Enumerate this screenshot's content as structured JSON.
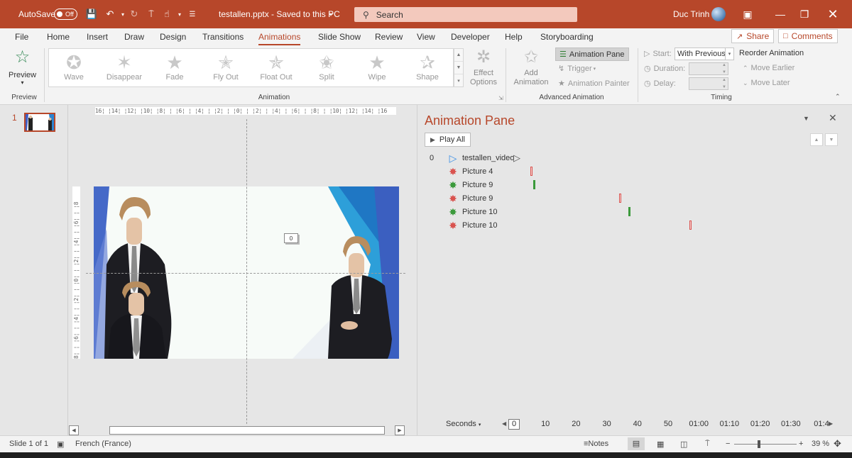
{
  "titlebar": {
    "autosave_label": "AutoSave",
    "autosave_state": "Off",
    "document": "testallen.pptx  -  Saved to this PC",
    "search_placeholder": "Search",
    "user": "Duc Trinh",
    "accent": "#b7472a"
  },
  "menu": {
    "tabs": [
      "File",
      "Home",
      "Insert",
      "Draw",
      "Design",
      "Transitions",
      "Animations",
      "Slide Show",
      "Review",
      "View",
      "Developer",
      "Help",
      "Storyboarding"
    ],
    "active_tab": "Animations",
    "share_label": "Share",
    "comments_label": "Comments"
  },
  "ribbon": {
    "preview": {
      "label": "Preview",
      "group": "Preview"
    },
    "animation_group": "Animation",
    "animations": [
      "Wave",
      "Disappear",
      "Fade",
      "Fly Out",
      "Float Out",
      "Split",
      "Wipe",
      "Shape"
    ],
    "effect_options": "Effect Options",
    "add_animation": "Add Animation",
    "animation_pane": "Animation Pane",
    "trigger": "Trigger",
    "animation_painter": "Animation Painter",
    "advanced_group": "Advanced Animation",
    "start_label": "Start:",
    "start_value": "With Previous",
    "duration_label": "Duration:",
    "delay_label": "Delay:",
    "timing_group": "Timing",
    "reorder_title": "Reorder Animation",
    "move_earlier": "Move Earlier",
    "move_later": "Move Later"
  },
  "slides_panel": {
    "slide_number": "1"
  },
  "editor": {
    "hruler_text": "16¦ ¦14¦ ¦12¦ ¦10¦ ¦8¦ ¦ ¦6¦ ¦ ¦4¦ ¦ ¦2¦ ¦ ¦0¦ ¦ ¦2¦ ¦ ¦4¦ ¦ ¦6¦ ¦ ¦8¦ ¦ ¦10¦ ¦12¦ ¦14¦ ¦16",
    "vruler_text": "8¦ ¦ ¦6¦ ¦ ¦4¦ ¦ ¦2¦ ¦ ¦0¦ ¦ ¦2¦ ¦ ¦4¦ ¦ ¦6¦ ¦ ¦8",
    "anim_tag": "0"
  },
  "animation_pane": {
    "title": "Animation Pane",
    "play_all": "Play All",
    "items": [
      {
        "order": "0",
        "name": "testallen_video",
        "type": "play",
        "color": "#3a8ee6",
        "bar_seconds": null
      },
      {
        "order": "",
        "name": "Picture 4",
        "type": "exit",
        "color": "#d9534f",
        "bar_seconds": 5
      },
      {
        "order": "",
        "name": "Picture 9",
        "type": "entrance",
        "color": "#3b9a3b",
        "bar_seconds": 6
      },
      {
        "order": "",
        "name": "Picture 9",
        "type": "exit",
        "color": "#d9534f",
        "bar_seconds": 34
      },
      {
        "order": "",
        "name": "Picture 10",
        "type": "entrance",
        "color": "#3b9a3b",
        "bar_seconds": 37
      },
      {
        "order": "",
        "name": "Picture 10",
        "type": "exit",
        "color": "#d9534f",
        "bar_seconds": 57
      }
    ],
    "timeline_label": "Seconds",
    "ticks": [
      "0",
      "10",
      "20",
      "30",
      "40",
      "50",
      "01:00",
      "01:10",
      "01:20",
      "01:30",
      "01:4"
    ]
  },
  "statusbar": {
    "slide_info": "Slide 1 of 1",
    "language": "French (France)",
    "notes": "Notes",
    "zoom": "39 %",
    "zoom_fraction": 0.4
  }
}
